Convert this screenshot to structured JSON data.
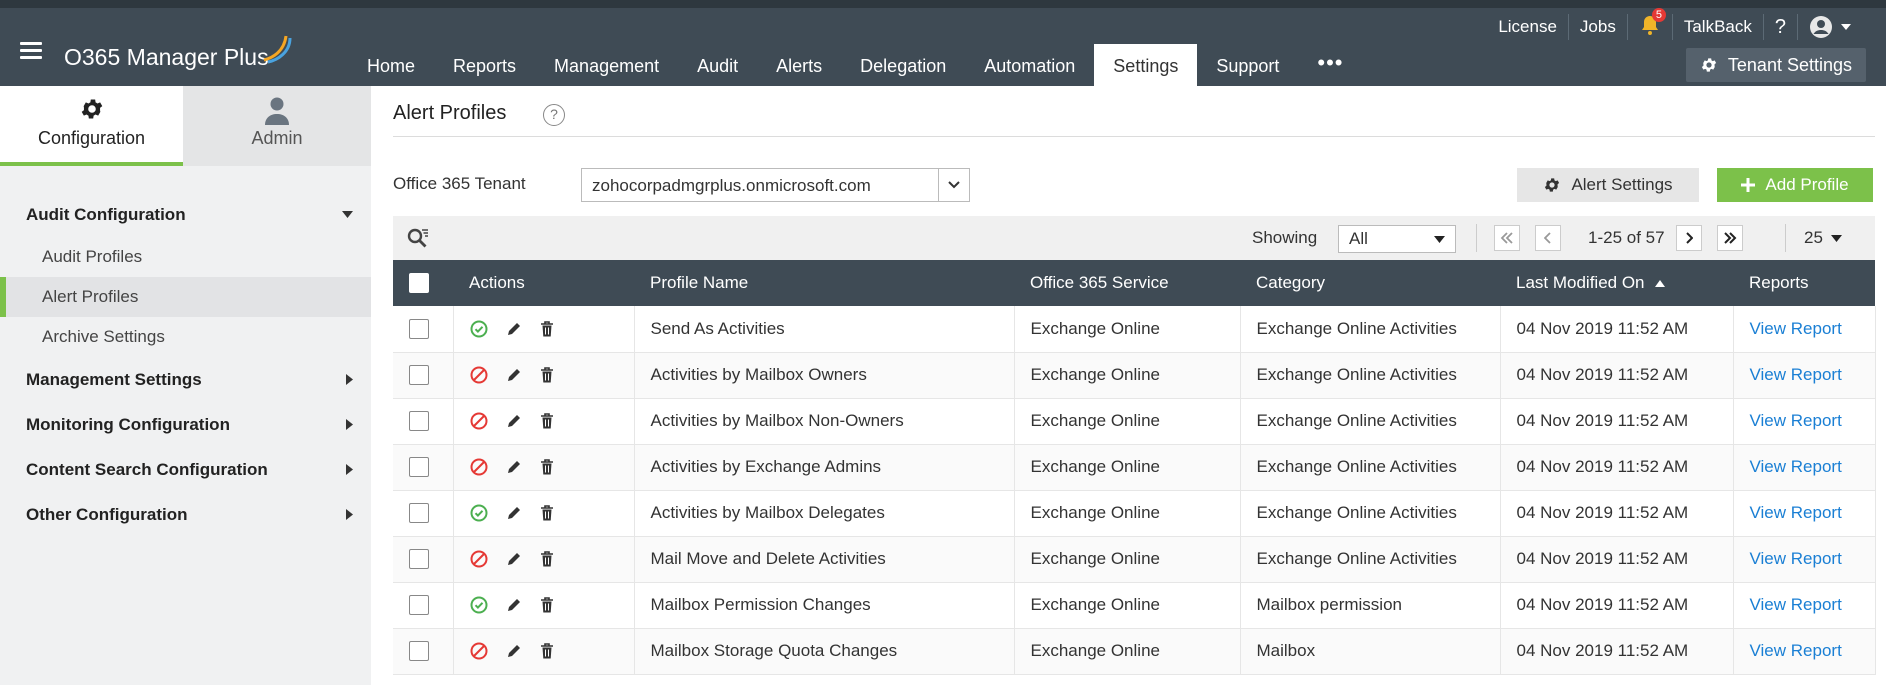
{
  "app": {
    "brand": "O365 Manager Plus",
    "colors": {
      "header": "#3f4b55",
      "accent": "#7cc14a",
      "link": "#1a7fd4"
    }
  },
  "top_nav": {
    "tabs": [
      "Home",
      "Reports",
      "Management",
      "Audit",
      "Alerts",
      "Delegation",
      "Automation",
      "Settings",
      "Support"
    ],
    "active": "Settings",
    "more": "•••"
  },
  "utility": {
    "license": "License",
    "jobs": "Jobs",
    "notifications": "5",
    "talkback": "TalkBack",
    "help": "?",
    "tenant_settings": "Tenant Settings"
  },
  "sidebar": {
    "tabs": {
      "configuration": "Configuration",
      "admin": "Admin"
    },
    "menu": {
      "audit_configuration": "Audit Configuration",
      "audit_profiles": "Audit Profiles",
      "alert_profiles": "Alert Profiles",
      "archive_settings": "Archive Settings",
      "management_settings": "Management Settings",
      "monitoring_configuration": "Monitoring Configuration",
      "content_search_configuration": "Content Search Configuration",
      "other_configuration": "Other Configuration"
    }
  },
  "main": {
    "title": "Alert Profiles",
    "help": "?",
    "tenant_label": "Office 365 Tenant",
    "tenant_value": "zohocorpadmgrplus.onmicrosoft.com",
    "alert_settings": "Alert Settings",
    "add_profile": "Add Profile",
    "showing_label": "Showing",
    "showing_value": "All",
    "page_info": "1-25 of 57",
    "per_page": "25"
  },
  "table": {
    "columns": {
      "actions": "Actions",
      "profile_name": "Profile Name",
      "service": "Office 365 Service",
      "category": "Category",
      "modified": "Last Modified On",
      "reports": "Reports"
    },
    "rows": [
      {
        "enabled": true,
        "name": "Send As Activities",
        "service": "Exchange Online",
        "category": "Exchange Online Activities",
        "modified": "04 Nov 2019 11:52 AM",
        "report": "View Report"
      },
      {
        "enabled": false,
        "name": "Activities by Mailbox Owners",
        "service": "Exchange Online",
        "category": "Exchange Online Activities",
        "modified": "04 Nov 2019 11:52 AM",
        "report": "View Report"
      },
      {
        "enabled": false,
        "name": "Activities by Mailbox Non-Owners",
        "service": "Exchange Online",
        "category": "Exchange Online Activities",
        "modified": "04 Nov 2019 11:52 AM",
        "report": "View Report"
      },
      {
        "enabled": false,
        "name": "Activities by Exchange Admins",
        "service": "Exchange Online",
        "category": "Exchange Online Activities",
        "modified": "04 Nov 2019 11:52 AM",
        "report": "View Report"
      },
      {
        "enabled": true,
        "name": "Activities by Mailbox Delegates",
        "service": "Exchange Online",
        "category": "Exchange Online Activities",
        "modified": "04 Nov 2019 11:52 AM",
        "report": "View Report"
      },
      {
        "enabled": false,
        "name": "Mail Move and Delete Activities",
        "service": "Exchange Online",
        "category": "Exchange Online Activities",
        "modified": "04 Nov 2019 11:52 AM",
        "report": "View Report"
      },
      {
        "enabled": true,
        "name": "Mailbox Permission Changes",
        "service": "Exchange Online",
        "category": "Mailbox permission",
        "modified": "04 Nov 2019 11:52 AM",
        "report": "View Report"
      },
      {
        "enabled": false,
        "name": "Mailbox Storage Quota Changes",
        "service": "Exchange Online",
        "category": "Mailbox",
        "modified": "04 Nov 2019 11:52 AM",
        "report": "View Report"
      }
    ]
  }
}
